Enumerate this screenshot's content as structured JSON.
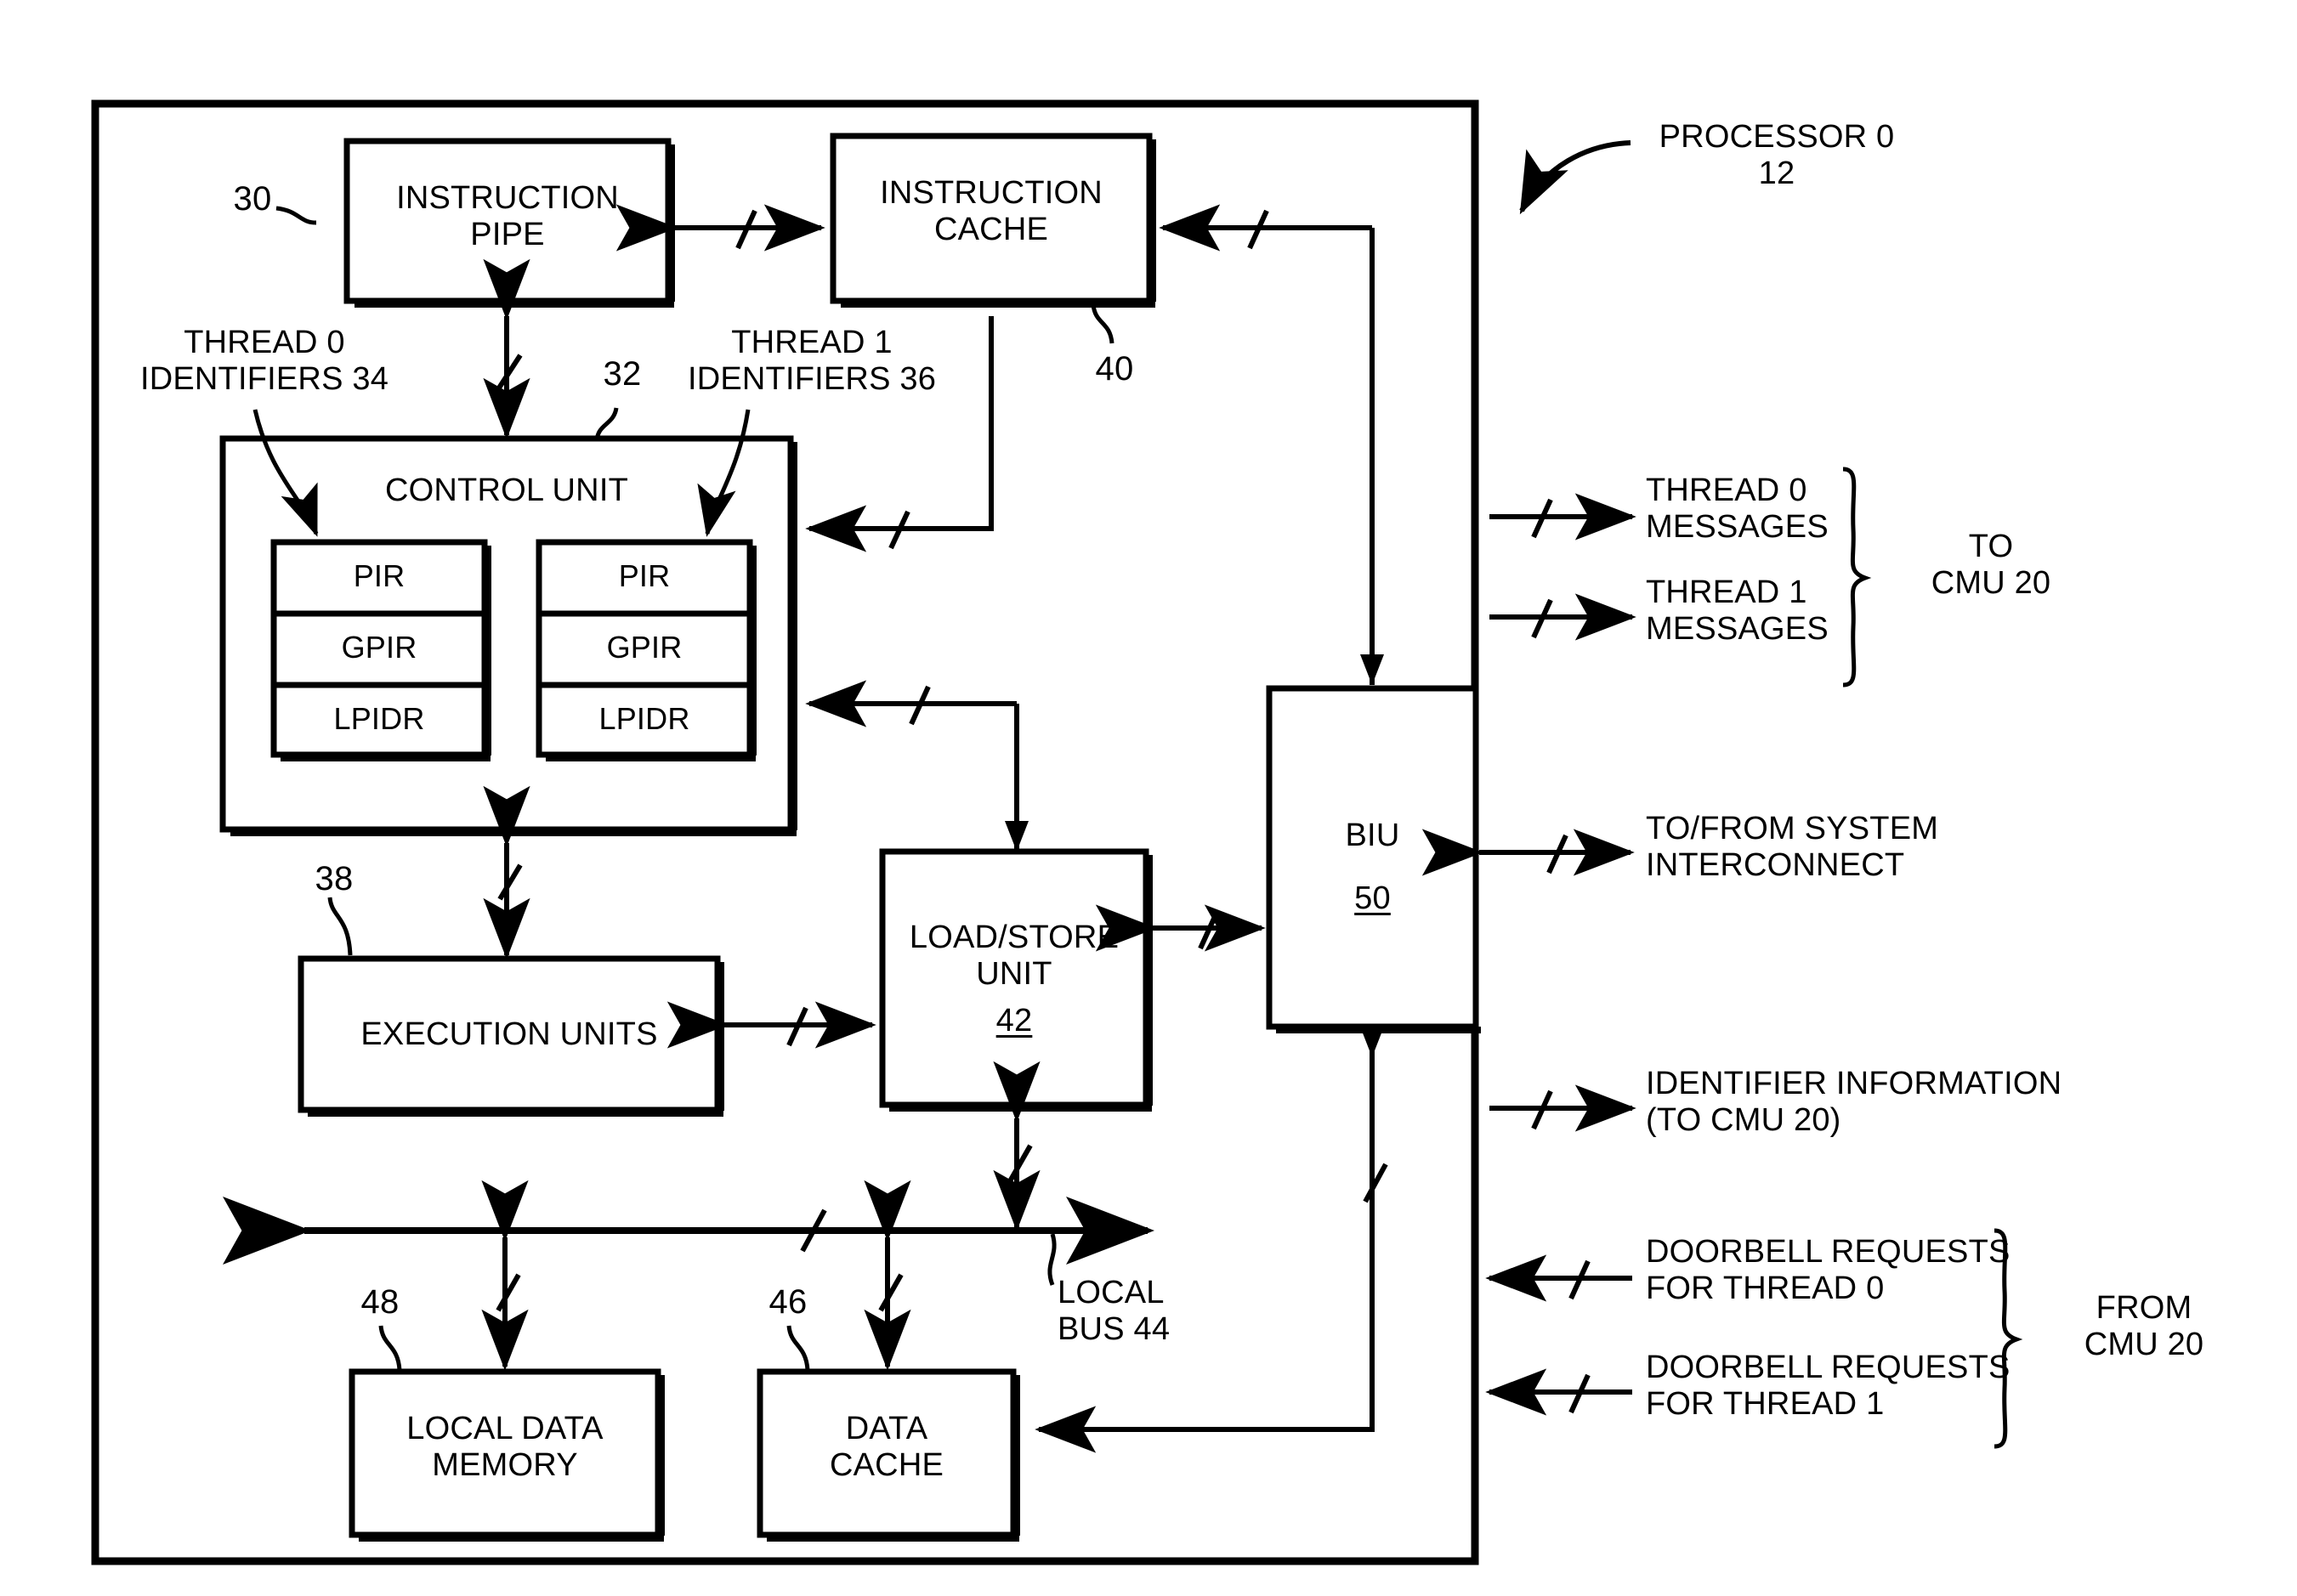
{
  "figure": {
    "type": "patent-block-diagram",
    "title_callout": "PROCESSOR 0\n12"
  },
  "blocks": {
    "instruction_pipe": {
      "label": "INSTRUCTION\nPIPE",
      "ref": "30"
    },
    "instruction_cache": {
      "label": "INSTRUCTION\nCACHE",
      "ref": "40"
    },
    "control_unit": {
      "label": "CONTROL UNIT",
      "ref": "32"
    },
    "execution_units": {
      "label": "EXECUTION UNITS",
      "ref": "38"
    },
    "load_store_unit": {
      "label": "LOAD/STORE\nUNIT",
      "ref": "42"
    },
    "biu": {
      "label": "BIU",
      "ref": "50"
    },
    "local_data_memory": {
      "label": "LOCAL DATA\nMEMORY",
      "ref": "48"
    },
    "data_cache": {
      "label": "DATA\nCACHE",
      "ref": "46"
    },
    "local_bus": {
      "label": "LOCAL\nBUS 44"
    }
  },
  "registers": {
    "thread0": {
      "callout": "THREAD 0\nIDENTIFIERS 34",
      "rows": [
        "PIR",
        "GPIR",
        "LPIDR"
      ]
    },
    "thread1": {
      "callout": "THREAD 1\nIDENTIFIERS 36",
      "rows": [
        "PIR",
        "GPIR",
        "LPIDR"
      ]
    }
  },
  "external_signals": [
    {
      "name": "thread-0-messages",
      "label": "THREAD 0\nMESSAGES",
      "direction": "out"
    },
    {
      "name": "thread-1-messages",
      "label": "THREAD 1\nMESSAGES",
      "direction": "out"
    },
    {
      "name": "to-from-system-interconnect",
      "label": "TO/FROM SYSTEM\nINTERCONNECT",
      "direction": "bidirectional"
    },
    {
      "name": "identifier-information",
      "label": "IDENTIFIER INFORMATION\n(TO CMU 20)",
      "direction": "out"
    },
    {
      "name": "doorbell-requests-thread-0",
      "label": "DOORBELL REQUESTS\nFOR THREAD 0",
      "direction": "in"
    },
    {
      "name": "doorbell-requests-thread-1",
      "label": "DOORBELL REQUESTS\nFOR THREAD 1",
      "direction": "in"
    }
  ],
  "braces": {
    "messages_target": "TO\nCMU 20",
    "doorbell_source": "FROM\nCMU 20"
  },
  "colors": {
    "line": "#000000",
    "background": "#ffffff"
  }
}
